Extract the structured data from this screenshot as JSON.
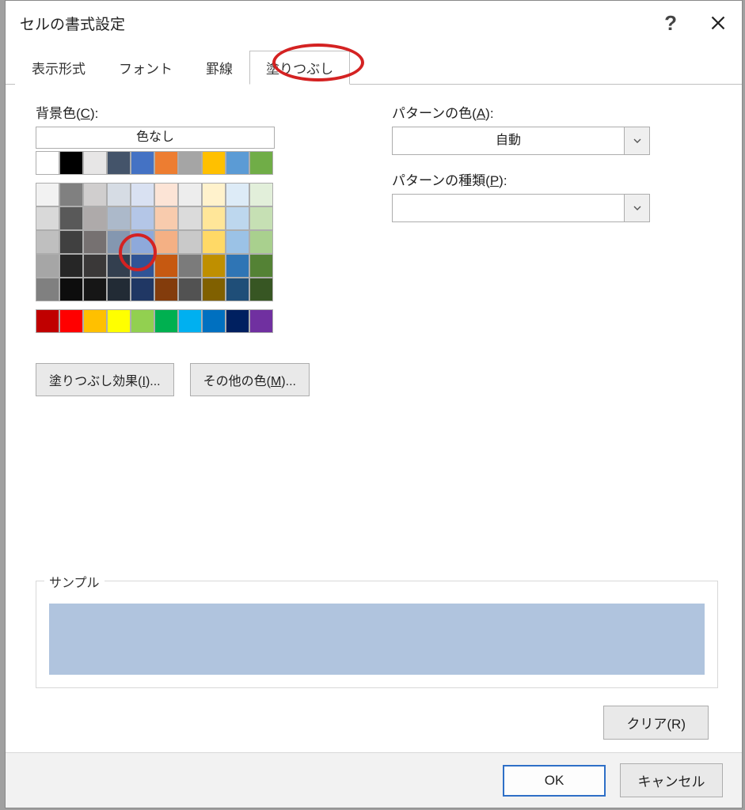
{
  "title": "セルの書式設定",
  "help_char": "?",
  "tabs": {
    "t0": "表示形式",
    "t1": "フォント",
    "t2": "罫線",
    "t3": "塗りつぶし"
  },
  "bg_color_label_pre": "背景色(",
  "bg_color_label_u": "C",
  "bg_color_label_post": "):",
  "no_color": "色なし",
  "fill_effects_pre": "塗りつぶし効果(",
  "fill_effects_u": "I",
  "fill_effects_post": ")...",
  "other_colors_pre": "その他の色(",
  "other_colors_u": "M",
  "other_colors_post": ")...",
  "pattern_color_label_pre": "パターンの色(",
  "pattern_color_label_u": "A",
  "pattern_color_label_post": "):",
  "pattern_color_value": "自動",
  "pattern_style_label_pre": "パターンの種類(",
  "pattern_style_label_u": "P",
  "pattern_style_label_post": "):",
  "pattern_style_value": "",
  "sample_label": "サンプル",
  "sample_color": "#b0c4de",
  "clear_pre": "クリア(",
  "clear_u": "R",
  "clear_post": ")",
  "ok": "OK",
  "cancel": "キャンセル",
  "palette_row0": [
    "#ffffff",
    "#000000",
    "#e7e6e6",
    "#44546a",
    "#4472c4",
    "#ed7d31",
    "#a5a5a5",
    "#ffc000",
    "#5b9bd5",
    "#70ad47"
  ],
  "palette_theme": [
    [
      "#f2f2f2",
      "#808080",
      "#d0cece",
      "#d6dce4",
      "#d9e1f2",
      "#fce4d6",
      "#ededed",
      "#fff2cc",
      "#ddebf7",
      "#e2efda"
    ],
    [
      "#d9d9d9",
      "#595959",
      "#aeaaaa",
      "#acb9ca",
      "#b4c6e7",
      "#f8cbad",
      "#dbdbdb",
      "#ffe699",
      "#bdd7ee",
      "#c6e0b4"
    ],
    [
      "#bfbfbf",
      "#404040",
      "#767171",
      "#8497b0",
      "#8ea9db",
      "#f4b084",
      "#c9c9c9",
      "#ffd966",
      "#9bc2e6",
      "#a9d08e"
    ],
    [
      "#a6a6a6",
      "#262626",
      "#3a3838",
      "#333f4f",
      "#305496",
      "#c65911",
      "#7b7b7b",
      "#bf8f00",
      "#2f75b5",
      "#548235"
    ],
    [
      "#808080",
      "#0d0d0d",
      "#161616",
      "#222b35",
      "#203764",
      "#833c0c",
      "#525252",
      "#806000",
      "#1f4e78",
      "#375623"
    ]
  ],
  "palette_standard": [
    "#c00000",
    "#ff0000",
    "#ffc000",
    "#ffff00",
    "#92d050",
    "#00b050",
    "#00b0f0",
    "#0070c0",
    "#002060",
    "#7030a0"
  ]
}
